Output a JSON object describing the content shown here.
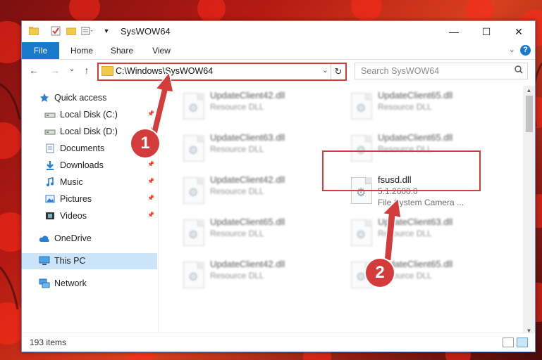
{
  "window": {
    "title": "SysWOW64",
    "controls": {
      "minimize": "—",
      "maximize": "☐",
      "close": "✕"
    }
  },
  "ribbon": {
    "tabs": [
      "File",
      "Home",
      "Share",
      "View"
    ],
    "help": "?"
  },
  "navbar": {
    "back_icon": "←",
    "forward_icon": "→",
    "recent_icon": "⌄",
    "up_icon": "↑",
    "address": "C:\\Windows\\SysWOW64",
    "search_placeholder": "Search SysWOW64"
  },
  "sidebar": {
    "items": [
      {
        "label": "Quick access",
        "icon": "star-icon",
        "pinned": false
      },
      {
        "label": "Local Disk (C:)",
        "icon": "drive-icon",
        "pinned": true
      },
      {
        "label": "Local Disk (D:)",
        "icon": "drive-icon",
        "pinned": true
      },
      {
        "label": "Documents",
        "icon": "document-icon",
        "pinned": true
      },
      {
        "label": "Downloads",
        "icon": "download-icon",
        "pinned": true
      },
      {
        "label": "Music",
        "icon": "music-icon",
        "pinned": true
      },
      {
        "label": "Pictures",
        "icon": "pictures-icon",
        "pinned": true
      },
      {
        "label": "Videos",
        "icon": "videos-icon",
        "pinned": true
      },
      {
        "label": "OneDrive",
        "icon": "cloud-icon",
        "pinned": false
      },
      {
        "label": "This PC",
        "icon": "computer-icon",
        "pinned": false,
        "selected": true
      },
      {
        "label": "Network",
        "icon": "network-icon",
        "pinned": false
      }
    ]
  },
  "files": [
    {
      "name": "UpdateClient42.dll",
      "detail": "Resource DLL",
      "blurred": true
    },
    {
      "name": "UpdateClient65.dll",
      "detail": "Resource DLL",
      "blurred": true
    },
    {
      "name": "UpdateClient63.dll",
      "detail": "Resource DLL",
      "blurred": true
    },
    {
      "name": "UpdateClient65.dll",
      "detail": "Resource DLL",
      "blurred": true
    },
    {
      "name": "UpdateClient42.dll",
      "detail": "Resource DLL",
      "blurred": true
    },
    {
      "name": "fsusd.dll",
      "detail": "5.1.2600.0",
      "detail2": "File System Camera ...",
      "blurred": false,
      "highlighted": true
    },
    {
      "name": "UpdateClient65.dll",
      "detail": "Resource DLL",
      "blurred": true
    },
    {
      "name": "UpdateClient63.dll",
      "detail": "Resource DLL",
      "blurred": true
    },
    {
      "name": "UpdateClient42.dll",
      "detail": "Resource DLL",
      "blurred": true
    },
    {
      "name": "UpdateClient65.dll",
      "detail": "Resource DLL",
      "blurred": true
    }
  ],
  "status": {
    "item_count": "193 items"
  },
  "annotations": [
    {
      "number": "1"
    },
    {
      "number": "2"
    }
  ],
  "colors": {
    "accent": "#1979ca",
    "annotation_red": "#d43b3b",
    "selected": "#cce4f7"
  }
}
